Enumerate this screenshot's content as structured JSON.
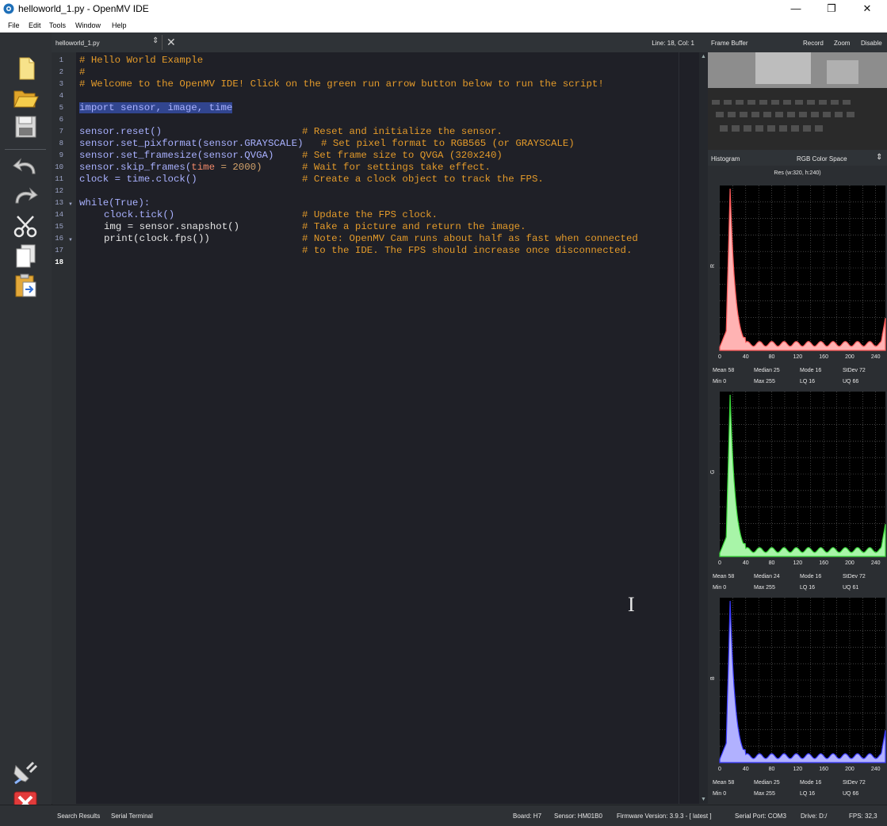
{
  "window": {
    "title": "helloworld_1.py - OpenMV IDE",
    "minimize_glyph": "—",
    "maximize_glyph": "❐",
    "close_glyph": "✕"
  },
  "menu": [
    "File",
    "Edit",
    "Tools",
    "Window",
    "Help"
  ],
  "sidebar": {
    "buttons": [
      "new-file",
      "open-file",
      "save",
      "undo",
      "redo",
      "cut",
      "copy",
      "paste",
      "connect",
      "stop"
    ]
  },
  "editor": {
    "tab_name": "helloworld_1.py",
    "line_info": "Line: 18, Col: 1",
    "line_numbers": [
      "1",
      "2",
      "3",
      "4",
      "5",
      "6",
      "7",
      "8",
      "9",
      "10",
      "11",
      "12",
      "13",
      "14",
      "15",
      "16",
      "17",
      "18"
    ]
  },
  "code": {
    "l1": "# Hello World Example",
    "l2": "#",
    "l3": "# Welcome to the OpenMV IDE! Click on the green run arrow button below to run the script!",
    "l5": "import sensor, image, time",
    "l7a": "sensor.reset()",
    "l7c": "# Reset and initialize the sensor.",
    "l8a": "sensor.set_pixformat(sensor.GRAYSCALE)",
    "l8c": "# Set pixel format to RGB565 (or GRAYSCALE)",
    "l9a": "sensor.set_framesize(sensor.QVGA)",
    "l9c": "# Set frame size to QVGA (320x240)",
    "l10a": "sensor.skip_frames(",
    "l10b": "time",
    "l10c": " = 2000)",
    "l10d": "# Wait for settings take effect.",
    "l11a": "clock = time.clock()",
    "l11c": "# Create a clock object to track the FPS.",
    "l13": "while(True):",
    "l14a": "clock.tick()",
    "l14c": "# Update the FPS clock.",
    "l15a": "img = sensor.snapshot()",
    "l15c": "# Take a picture and return the image.",
    "l16a": "print(clock.fps())",
    "l16c": "# Note: OpenMV Cam runs about half as fast when connected",
    "l17c": "# to the IDE. The FPS should increase once disconnected."
  },
  "frame_buffer": {
    "label": "Frame Buffer",
    "record": "Record",
    "zoom": "Zoom",
    "disable": "Disable"
  },
  "histogram": {
    "label": "Histogram",
    "color_space": "RGB Color Space",
    "resolution": "Res (w:320, h:240)",
    "x_ticks": [
      "0",
      "40",
      "80",
      "120",
      "160",
      "200",
      "240"
    ],
    "channels": [
      {
        "name": "R",
        "color": "#ff5a5a",
        "fill": "#ffb3b3",
        "stats": {
          "mean": "58",
          "median": "25",
          "mode": "16",
          "stdev": "72",
          "min": "0",
          "max": "255",
          "lq": "16",
          "uq": "66"
        }
      },
      {
        "name": "G",
        "color": "#39d639",
        "fill": "#a8f5a8",
        "stats": {
          "mean": "58",
          "median": "24",
          "mode": "16",
          "stdev": "72",
          "min": "0",
          "max": "255",
          "lq": "16",
          "uq": "61"
        }
      },
      {
        "name": "B",
        "color": "#3b3bff",
        "fill": "#b1b1ff",
        "stats": {
          "mean": "58",
          "median": "25",
          "mode": "16",
          "stdev": "72",
          "min": "0",
          "max": "255",
          "lq": "16",
          "uq": "66"
        }
      }
    ]
  },
  "status_bar": {
    "search_results": "Search Results",
    "serial_terminal": "Serial Terminal",
    "board": "Board: H7",
    "sensor": "Sensor: HM01B0",
    "firmware": "Firmware Version: 3.9.3 - [ latest ]",
    "serial_port": "Serial Port: COM3",
    "drive": "Drive: D:/",
    "fps": "FPS: 32,3"
  },
  "colors": {
    "editor_bg": "#1f2027",
    "comment": "#e39a2a",
    "keyword": "#a9b1ff",
    "selection": "#31458f"
  }
}
